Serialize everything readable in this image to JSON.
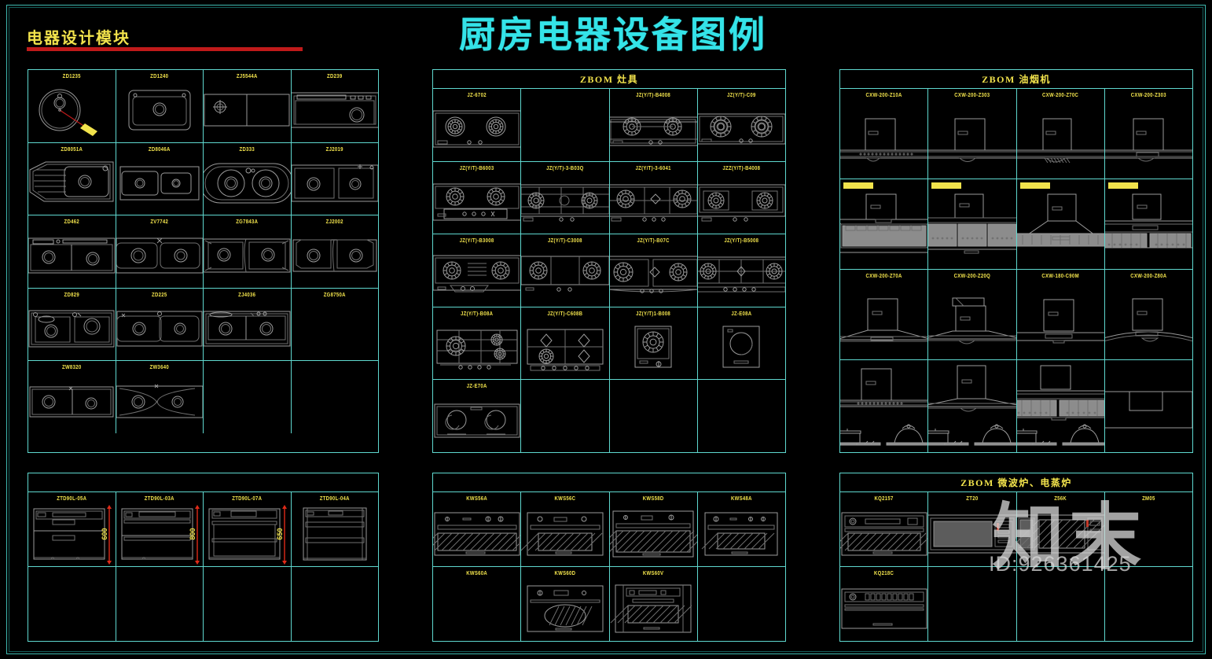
{
  "document": {
    "main_title": "厨房电器设备图例",
    "module_title": "电器设计模块",
    "watermark_text": "知末",
    "watermark_id": "ID:926361425",
    "colors": {
      "background": "#000000",
      "grid_line": "#5fd8cf",
      "label_text": "#f2e34c",
      "main_title": "#34e3e8",
      "underline": "#c01a1a",
      "drawing_line": "#9a9a9a",
      "dimension": "#e02a18"
    }
  },
  "panels": {
    "sinks": {
      "header": "",
      "rows": [
        [
          {
            "label": "ZD1235",
            "art": "sink-round-mag"
          },
          {
            "label": "ZD1240",
            "art": "sink-square-single"
          },
          {
            "label": "ZJ5544A",
            "art": "sink-rect-split"
          },
          {
            "label": "ZD239",
            "art": "sink-rect-drain"
          }
        ],
        [
          {
            "label": "ZD8051A",
            "art": "sink-angled-board"
          },
          {
            "label": "ZD8046A",
            "art": "sink-double-small"
          },
          {
            "label": "ZD333",
            "art": "sink-double-oval"
          },
          {
            "label": "ZJ2019",
            "art": "sink-double-square"
          }
        ],
        [
          {
            "label": "ZD462",
            "art": "sink-double-flat"
          },
          {
            "label": "ZV7742",
            "art": "sink-double-round"
          },
          {
            "label": "ZG7843A",
            "art": "sink-double-corner"
          },
          {
            "label": "ZJ2002",
            "art": "sink-double-chamfer"
          }
        ],
        [
          {
            "label": "ZD829",
            "art": "sink-double-tray"
          },
          {
            "label": "ZD225",
            "art": "sink-double-soft"
          },
          {
            "label": "ZJ4036",
            "art": "sink-double-board"
          },
          {
            "label": "ZG8750A",
            "art": "empty"
          }
        ],
        [
          {
            "label": "ZW8320",
            "art": "sink-double-plain"
          },
          {
            "label": "ZW3640",
            "art": "sink-double-wide"
          },
          {
            "label": "",
            "art": "empty"
          },
          {
            "label": "",
            "art": "empty"
          }
        ]
      ]
    },
    "cooktops": {
      "header": "ZBOM  灶具",
      "rows": [
        [
          {
            "label": "JZ-6702",
            "art": "hob-2burner-flat"
          },
          {
            "label": "",
            "art": "empty"
          },
          {
            "label": "JZ(Y/T)-B4008",
            "art": "hob-2burner-frame"
          },
          {
            "label": "JZ(Y/T)-C09",
            "art": "hob-2burner-spiral"
          }
        ],
        [
          {
            "label": "JZ(Y/T)-B6003",
            "art": "hob-2burner-panel"
          },
          {
            "label": "JZ(Y/T)-3-B03Q",
            "art": "hob-3burner-grid"
          },
          {
            "label": "JZ(Y/T)-3-6041",
            "art": "hob-3burner-wide"
          },
          {
            "label": "JZZ(Y/T)-B4008",
            "art": "hob-2burner-grid"
          }
        ],
        [
          {
            "label": "JZ(Y/T)-B3008",
            "art": "hob-2burner-center"
          },
          {
            "label": "JZ(Y/T)-C3008",
            "art": "hob-2burner-split"
          },
          {
            "label": "JZ(Y/T)-B07C",
            "art": "hob-3burner-large"
          },
          {
            "label": "JZ(Y/T)-B5008",
            "art": "hob-3burner-full"
          }
        ],
        [
          {
            "label": "JZ(Y/T)-B08A",
            "art": "hob-corner-grid"
          },
          {
            "label": "JZ(Y/T)-C608B",
            "art": "hob-4burner"
          },
          {
            "label": "JZ(Y/T)1-B008",
            "art": "hob-1burner"
          },
          {
            "label": "JZ-E08A",
            "art": "hob-induction-single"
          }
        ],
        [
          {
            "label": "JZ-E70A",
            "art": "hob-induction-double"
          },
          {
            "label": "",
            "art": "empty"
          },
          {
            "label": "",
            "art": "empty"
          },
          {
            "label": "",
            "art": "empty"
          }
        ]
      ]
    },
    "hoods": {
      "header": "ZBOM  油烟机",
      "rows": [
        [
          {
            "label": "CXW-200-Z10A",
            "art": "hood-tbar-perf"
          },
          {
            "label": "CXW-200-Z303",
            "art": "hood-tbar-plain"
          },
          {
            "label": "CXW-200-Z70C",
            "art": "hood-tbar-mesh"
          },
          {
            "label": "CXW-200-Z303",
            "art": "hood-tbar-wide"
          }
        ],
        [
          {
            "label": "",
            "highlight": true,
            "art": "hood-side-deep"
          },
          {
            "label": "",
            "highlight": true,
            "art": "hood-side-3panel"
          },
          {
            "label": "",
            "highlight": true,
            "art": "hood-side-slope"
          },
          {
            "label": "",
            "highlight": true,
            "art": "hood-side-grill"
          }
        ],
        [
          {
            "label": "CXW-200-Z70A",
            "art": "hood-euro-flat"
          },
          {
            "label": "CXW-200-Z20Q",
            "art": "hood-euro-box"
          },
          {
            "label": "CXW-180-C90M",
            "art": "hood-euro-thin"
          },
          {
            "label": "CXW-200-Z80A",
            "art": "hood-euro-curve"
          }
        ],
        [
          {
            "label": "",
            "art": "elev-hood-flat-pots"
          },
          {
            "label": "",
            "art": "elev-hood-euro-pots"
          },
          {
            "label": "",
            "art": "elev-hood-side-pots"
          },
          {
            "label": "",
            "art": "elev-cabinet-box"
          }
        ]
      ]
    },
    "disinfection": {
      "header": "",
      "rows": [
        [
          {
            "label": "ZTD90L-05A",
            "art": "cab-3drawer",
            "dim": "600"
          },
          {
            "label": "ZTD90L-03A",
            "art": "cab-2drawer",
            "dim": "800"
          },
          {
            "label": "ZTD90L-07A",
            "art": "cab-2door",
            "dim": "650"
          },
          {
            "label": "ZTD90L-04A",
            "art": "cab-2shelf",
            "dim": ""
          }
        ],
        [
          {
            "label": "",
            "art": "empty"
          },
          {
            "label": "",
            "art": "empty"
          },
          {
            "label": "",
            "art": "empty"
          },
          {
            "label": "",
            "art": "empty"
          }
        ]
      ]
    },
    "ovens": {
      "header": "",
      "rows": [
        [
          {
            "label": "KWS56A",
            "art": "oven-wide-glass"
          },
          {
            "label": "KWS56C",
            "art": "oven-small-glass"
          },
          {
            "label": "KWS58D",
            "art": "oven-tall-glass"
          },
          {
            "label": "KWS48A",
            "art": "oven-narrow-glass"
          }
        ],
        [
          {
            "label": "KWS60A",
            "art": "empty"
          },
          {
            "label": "KWS60D",
            "art": "oven-oval-glass"
          },
          {
            "label": "KWS60V",
            "art": "oven-framed-glass"
          },
          {
            "label": "",
            "art": "empty"
          }
        ]
      ]
    },
    "microwaves": {
      "header": "ZBOM  微波炉、电蒸炉",
      "rows": [
        [
          {
            "label": "KQ2157",
            "art": "mw-builtin-glass"
          },
          {
            "label": "ZT20",
            "art": "mw-countertop"
          },
          {
            "label": "Z56K",
            "art": "mw-steam"
          },
          {
            "label": "ZM05",
            "art": "empty"
          }
        ],
        [
          {
            "label": "KQ218C",
            "art": "mw-slim-panel"
          },
          {
            "label": "",
            "art": "empty"
          },
          {
            "label": "",
            "art": "empty"
          },
          {
            "label": "",
            "art": "empty"
          }
        ]
      ]
    }
  }
}
